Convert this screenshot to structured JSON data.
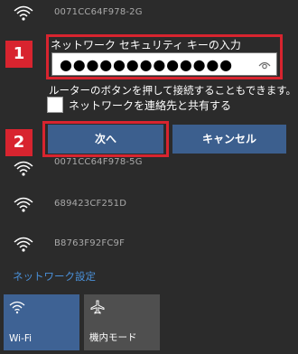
{
  "networks": [
    {
      "ssid": "0071CC64F978-2G"
    },
    {
      "ssid": "0071CC64F978-5G"
    },
    {
      "ssid": "689423CF251D"
    },
    {
      "ssid": "B8763F92FC9F"
    }
  ],
  "connect": {
    "key_label": "ネットワーク セキュリティ キーの入力",
    "key_value": "●●●●●●●●●●●●●",
    "hint": "ルーターのボタンを押して接続することもできます。",
    "share_label": "ネットワークを連絡先と共有する",
    "next_label": "次へ",
    "cancel_label": "キャンセル"
  },
  "badges": [
    "1",
    "2"
  ],
  "settings_link": "ネットワーク設定",
  "tiles": [
    {
      "label": "Wi-Fi",
      "icon": "wifi-icon"
    },
    {
      "label": "機内モード",
      "icon": "airplane-icon"
    }
  ],
  "colors": {
    "background": "#2b2b2b",
    "accent_button": "#3c5f8e",
    "highlight_red": "#d8242f",
    "link": "#4a90d9",
    "tile_active": "#3e6294",
    "tile_inactive": "#4f4f4f"
  }
}
